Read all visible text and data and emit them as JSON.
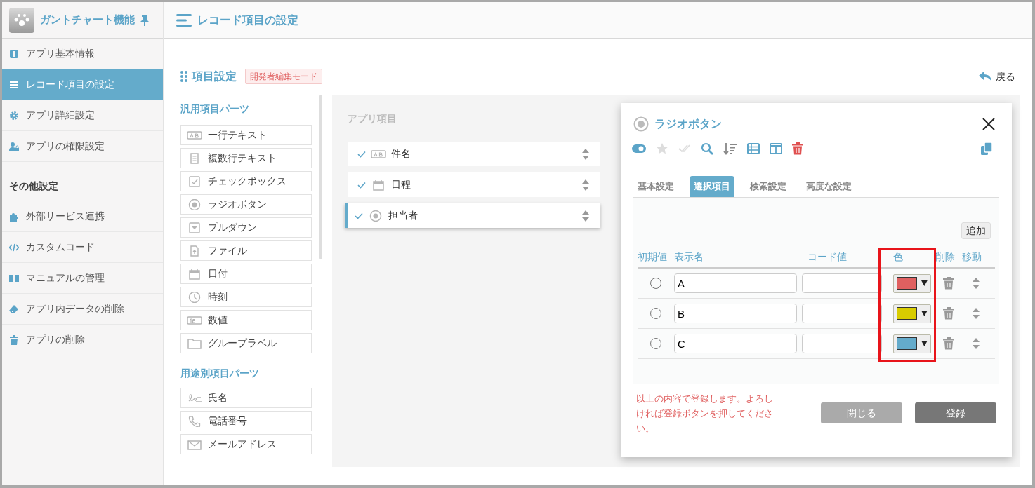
{
  "app": {
    "title": "ガントチャート機能"
  },
  "sidebar": {
    "items": [
      {
        "label": "アプリ基本情報",
        "kind": "info",
        "selected": false
      },
      {
        "label": "レコード項目の設定",
        "kind": "list",
        "selected": true
      },
      {
        "label": "アプリ詳細設定",
        "kind": "gear",
        "selected": false
      },
      {
        "label": "アプリの権限設定",
        "kind": "user-lock",
        "selected": false
      }
    ],
    "section_title": "その他設定",
    "other_items": [
      {
        "label": "外部サービス連携",
        "kind": "puzzle",
        "selected": false
      },
      {
        "label": "カスタムコード",
        "kind": "code",
        "selected": false
      },
      {
        "label": "マニュアルの管理",
        "kind": "book",
        "selected": false
      },
      {
        "label": "アプリ内データの削除",
        "kind": "eraser",
        "selected": false
      },
      {
        "label": "アプリの削除",
        "kind": "trash",
        "selected": false
      }
    ]
  },
  "header": {
    "title": "レコード項目の設定"
  },
  "section": {
    "title": "項目設定",
    "badge": "開発者編集モード",
    "back_label": "戻る"
  },
  "parts": {
    "general_title": "汎用項目パーツ",
    "general": [
      {
        "label": "一行テキスト",
        "kind": "ab"
      },
      {
        "label": "複数行テキスト",
        "kind": "doc"
      },
      {
        "label": "チェックボックス",
        "kind": "checkbox"
      },
      {
        "label": "ラジオボタン",
        "kind": "radio"
      },
      {
        "label": "プルダウン",
        "kind": "dropdown"
      },
      {
        "label": "ファイル",
        "kind": "file"
      },
      {
        "label": "日付",
        "kind": "calendar"
      },
      {
        "label": "時刻",
        "kind": "clock"
      },
      {
        "label": "数値",
        "kind": "number"
      },
      {
        "label": "グループラベル",
        "kind": "folder"
      }
    ],
    "specific_title": "用途別項目パーツ",
    "specific": [
      {
        "label": "氏名",
        "kind": "signature"
      },
      {
        "label": "電話番号",
        "kind": "phone"
      },
      {
        "label": "メールアドレス",
        "kind": "mail"
      }
    ]
  },
  "app_items": {
    "title": "アプリ項目",
    "items": [
      {
        "label": "件名",
        "kind": "ab",
        "selected": false
      },
      {
        "label": "日程",
        "kind": "calendar",
        "selected": false
      },
      {
        "label": "担当者",
        "kind": "radio",
        "selected": true
      }
    ]
  },
  "dialog": {
    "title": "ラジオボタン",
    "toolbar": [
      {
        "kind": "toggle",
        "on": true
      },
      {
        "kind": "star",
        "on": false
      },
      {
        "kind": "double-check",
        "on": false
      },
      {
        "kind": "search",
        "on": true
      },
      {
        "kind": "sort",
        "on": true
      },
      {
        "kind": "table",
        "on": true
      },
      {
        "kind": "columns",
        "on": true
      },
      {
        "kind": "trash",
        "on": true
      }
    ],
    "tabs": [
      {
        "label": "基本設定",
        "selected": false
      },
      {
        "label": "選択項目",
        "selected": true
      },
      {
        "label": "検索設定",
        "selected": false
      },
      {
        "label": "高度な設定",
        "selected": false
      }
    ],
    "add_button": "追加",
    "columns": [
      "初期値",
      "表示名",
      "コード値",
      "色",
      "削除",
      "移動"
    ],
    "rows": [
      {
        "default": false,
        "name": "A",
        "color": "#e06060"
      },
      {
        "default": false,
        "name": "B",
        "color": "#d8cc00"
      },
      {
        "default": false,
        "name": "C",
        "color": "#64abcb"
      }
    ],
    "message": "以上の内容で登録します。よろしければ登録ボタンを押してください。",
    "buttons": [
      {
        "label": "閉じる",
        "kind": "secondary"
      },
      {
        "label": "登録",
        "kind": "primary"
      }
    ]
  }
}
